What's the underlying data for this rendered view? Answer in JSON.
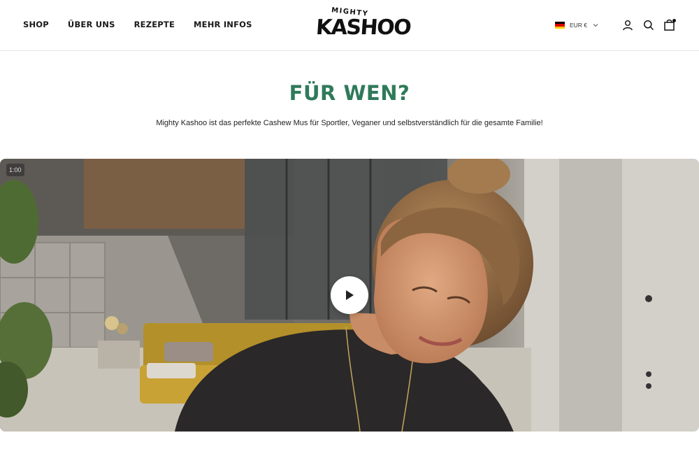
{
  "header": {
    "nav": [
      "SHOP",
      "ÜBER UNS",
      "REZEPTE",
      "MEHR INFOS"
    ],
    "logo_small": "MIGHTY",
    "logo_big": "KASHOO",
    "locale": {
      "currency": "EUR €",
      "flag": [
        "#000000",
        "#dd0000",
        "#ffce00"
      ]
    }
  },
  "section": {
    "title": "FÜR WEN?",
    "subtitle": "Mighty Kashoo ist das perfekte Cashew Mus für Sportler, Veganer und selbstverständlich für die gesamte Familie!"
  },
  "video": {
    "duration": "1:00"
  },
  "colors": {
    "accent": "#2f7a5a"
  }
}
